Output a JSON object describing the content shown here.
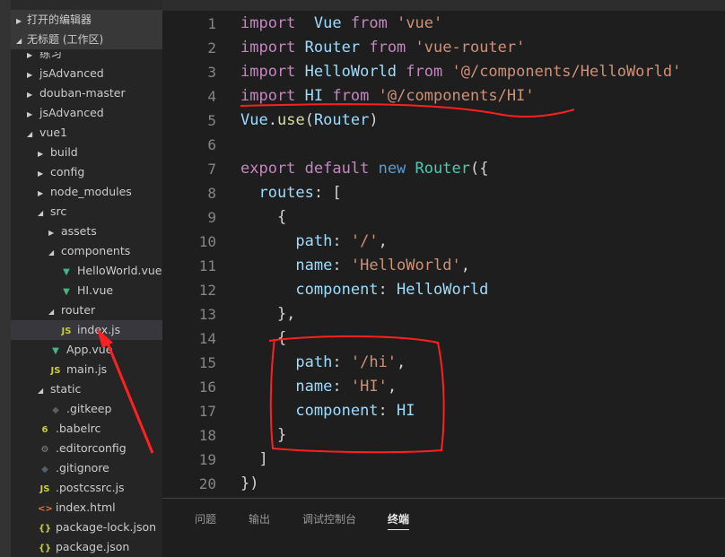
{
  "sidebar": {
    "sections": [
      {
        "label": "打开的编辑器",
        "expanded": false
      },
      {
        "label": "无标题 (工作区)",
        "expanded": true
      }
    ],
    "tree": [
      {
        "label": "练习",
        "depth": 0,
        "type": "folder",
        "expanded": false
      },
      {
        "label": "jsAdvanced",
        "depth": 0,
        "type": "folder",
        "expanded": false
      },
      {
        "label": "douban-master",
        "depth": 0,
        "type": "folder",
        "expanded": false
      },
      {
        "label": "jsAdvanced",
        "depth": 0,
        "type": "folder",
        "expanded": false
      },
      {
        "label": "vue1",
        "depth": 0,
        "type": "folder",
        "expanded": true
      },
      {
        "label": "build",
        "depth": 1,
        "type": "folder",
        "expanded": false
      },
      {
        "label": "config",
        "depth": 1,
        "type": "folder",
        "expanded": false
      },
      {
        "label": "node_modules",
        "depth": 1,
        "type": "folder",
        "expanded": false
      },
      {
        "label": "src",
        "depth": 1,
        "type": "folder",
        "expanded": true
      },
      {
        "label": "assets",
        "depth": 2,
        "type": "folder",
        "expanded": false
      },
      {
        "label": "components",
        "depth": 2,
        "type": "folder",
        "expanded": true
      },
      {
        "label": "HelloWorld.vue",
        "depth": 3,
        "type": "vue"
      },
      {
        "label": "HI.vue",
        "depth": 3,
        "type": "vue"
      },
      {
        "label": "router",
        "depth": 2,
        "type": "folder",
        "expanded": true
      },
      {
        "label": "index.js",
        "depth": 3,
        "type": "js",
        "selected": true
      },
      {
        "label": "App.vue",
        "depth": 2,
        "type": "vue"
      },
      {
        "label": "main.js",
        "depth": 2,
        "type": "js"
      },
      {
        "label": "static",
        "depth": 1,
        "type": "folder",
        "expanded": true
      },
      {
        "label": ".gitkeep",
        "depth": 2,
        "type": "git"
      },
      {
        "label": ".babelrc",
        "depth": 1,
        "type": "babel"
      },
      {
        "label": ".editorconfig",
        "depth": 1,
        "type": "gear"
      },
      {
        "label": ".gitignore",
        "depth": 1,
        "type": "git"
      },
      {
        "label": ".postcssrc.js",
        "depth": 1,
        "type": "js"
      },
      {
        "label": "index.html",
        "depth": 1,
        "type": "html"
      },
      {
        "label": "package-lock.json",
        "depth": 1,
        "type": "json"
      },
      {
        "label": "package.json",
        "depth": 1,
        "type": "json"
      }
    ]
  },
  "editor": {
    "lines": [
      [
        [
          "k",
          "import"
        ],
        [
          "",
          "  "
        ],
        [
          "v",
          "Vue"
        ],
        [
          "",
          " "
        ],
        [
          "k",
          "from"
        ],
        [
          "",
          " "
        ],
        [
          "s",
          "'vue'"
        ]
      ],
      [
        [
          "k",
          "import"
        ],
        [
          "",
          " "
        ],
        [
          "v",
          "Router"
        ],
        [
          "",
          " "
        ],
        [
          "k",
          "from"
        ],
        [
          "",
          " "
        ],
        [
          "s",
          "'vue-router'"
        ]
      ],
      [
        [
          "k",
          "import"
        ],
        [
          "",
          " "
        ],
        [
          "v",
          "HelloWorld"
        ],
        [
          "",
          " "
        ],
        [
          "k",
          "from"
        ],
        [
          "",
          " "
        ],
        [
          "s",
          "'@/components/HelloWorld'"
        ]
      ],
      [
        [
          "k",
          "import"
        ],
        [
          "",
          " "
        ],
        [
          "v",
          "HI"
        ],
        [
          "",
          " "
        ],
        [
          "k",
          "from"
        ],
        [
          "",
          " "
        ],
        [
          "s",
          "'@/components/HI'"
        ]
      ],
      [
        [
          "v",
          "Vue"
        ],
        [
          "",
          "."
        ],
        [
          "f",
          "use"
        ],
        [
          "",
          "("
        ],
        [
          "v",
          "Router"
        ],
        [
          "",
          ")"
        ]
      ],
      [],
      [
        [
          "k",
          "export"
        ],
        [
          "",
          " "
        ],
        [
          "k",
          "default"
        ],
        [
          "",
          " "
        ],
        [
          "b",
          "new"
        ],
        [
          "",
          " "
        ],
        [
          "t",
          "Router"
        ],
        [
          "",
          "({"
        ]
      ],
      [
        [
          "",
          "  "
        ],
        [
          "v",
          "routes"
        ],
        [
          "",
          ": ["
        ]
      ],
      [
        [
          "",
          "    {"
        ]
      ],
      [
        [
          "",
          "      "
        ],
        [
          "v",
          "path"
        ],
        [
          "",
          ": "
        ],
        [
          "s",
          "'/'"
        ],
        [
          "",
          ","
        ]
      ],
      [
        [
          "",
          "      "
        ],
        [
          "v",
          "name"
        ],
        [
          "",
          ": "
        ],
        [
          "s",
          "'HelloWorld'"
        ],
        [
          "",
          ","
        ]
      ],
      [
        [
          "",
          "      "
        ],
        [
          "v",
          "component"
        ],
        [
          "",
          ": "
        ],
        [
          "v",
          "HelloWorld"
        ]
      ],
      [
        [
          "",
          "    },"
        ]
      ],
      [
        [
          "",
          "    {"
        ]
      ],
      [
        [
          "",
          "      "
        ],
        [
          "v",
          "path"
        ],
        [
          "",
          ": "
        ],
        [
          "s",
          "'/hi'"
        ],
        [
          "",
          ","
        ]
      ],
      [
        [
          "",
          "      "
        ],
        [
          "v",
          "name"
        ],
        [
          "",
          ": "
        ],
        [
          "s",
          "'HI'"
        ],
        [
          "",
          ","
        ]
      ],
      [
        [
          "",
          "      "
        ],
        [
          "v",
          "component"
        ],
        [
          "",
          ": "
        ],
        [
          "v",
          "HI"
        ]
      ],
      [
        [
          "",
          "    }"
        ]
      ],
      [
        [
          "",
          "  ]"
        ]
      ],
      [
        [
          "",
          "})"
        ]
      ]
    ]
  },
  "panel": {
    "tabs": [
      {
        "label": "问题"
      },
      {
        "label": "输出"
      },
      {
        "label": "调试控制台"
      },
      {
        "label": "终端",
        "active": true
      }
    ]
  },
  "colors": {
    "annotation": "#ff2020",
    "keyword": "#c586c0",
    "string": "#ce9178",
    "variable": "#9cdcfe"
  }
}
